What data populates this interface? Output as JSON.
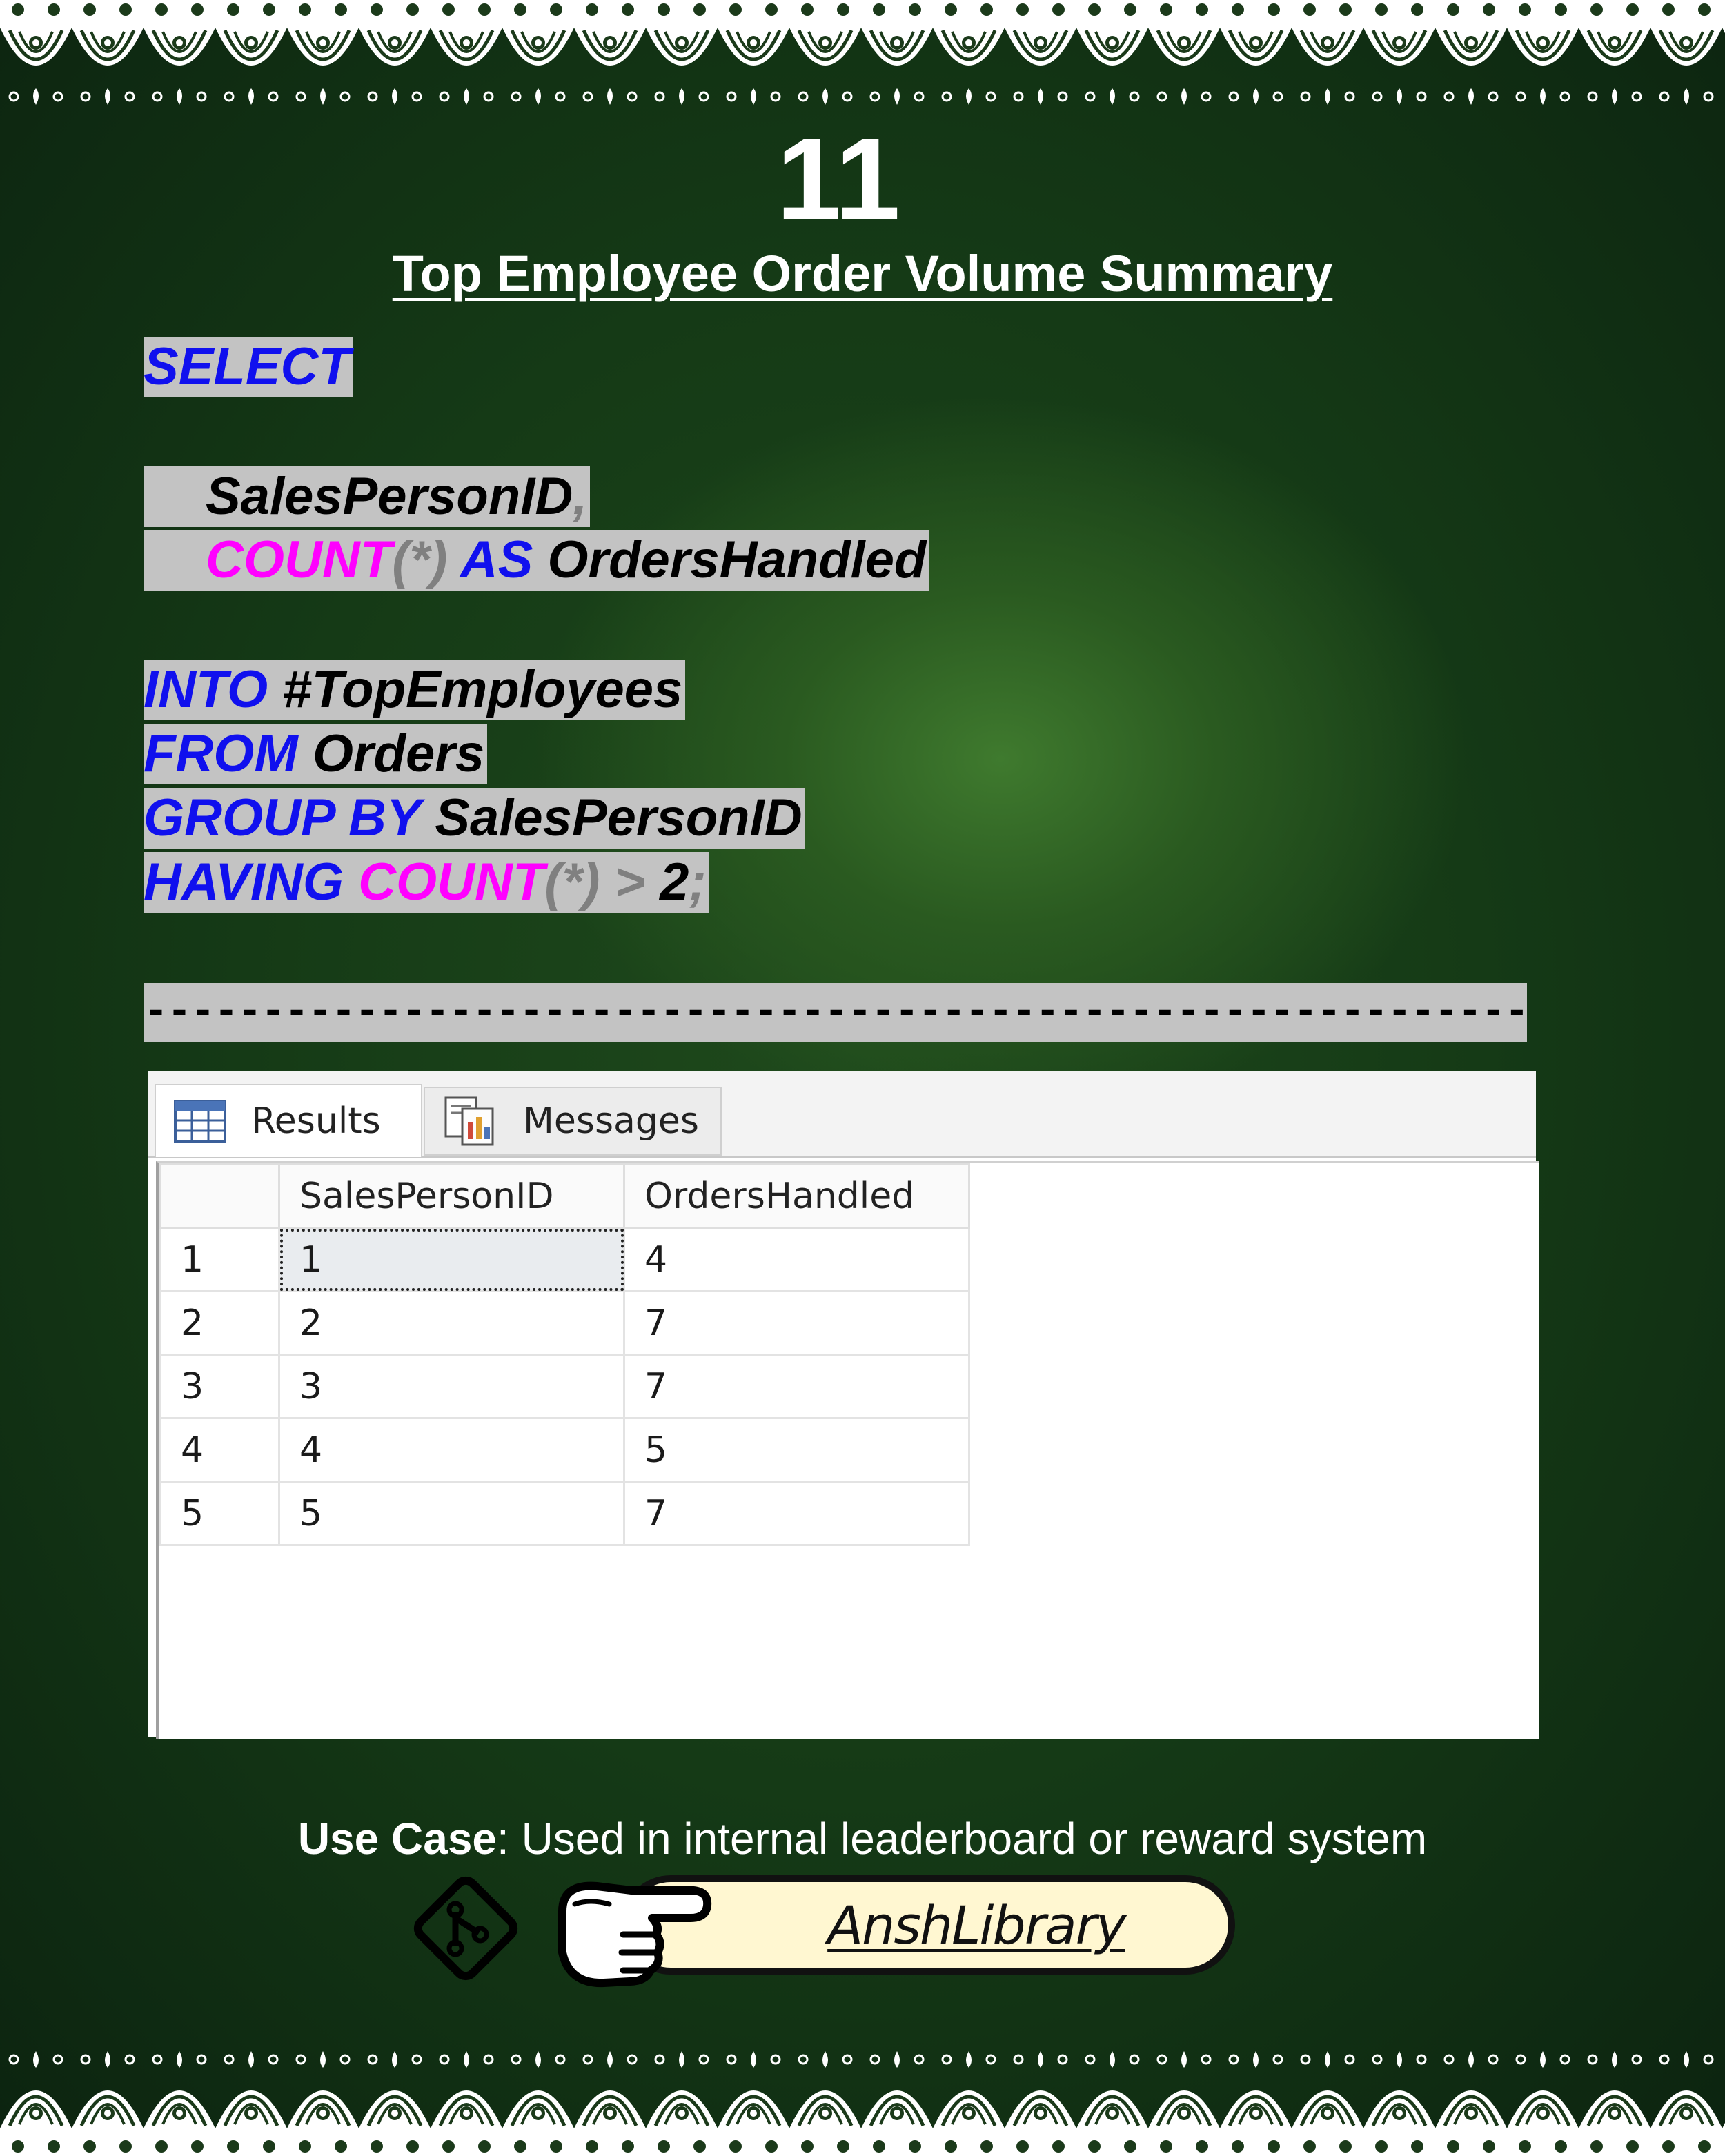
{
  "page_number": "11",
  "title": "Top Employee Order Volume Summary",
  "code": {
    "select": "SELECT",
    "col1": "SalesPersonID",
    "comma": ",",
    "count": "COUNT",
    "star": "(*)",
    "as": "AS",
    "alias": "OrdersHandled",
    "into": "INTO",
    "into_table": "#TopEmployees",
    "from": "FROM",
    "from_table": "Orders",
    "group_by": "GROUP BY",
    "group_col": "SalesPersonID",
    "having": "HAVING",
    "gt": ">",
    "threshold": "2",
    "semicolon": ";"
  },
  "separator": "-------------------------------------------------------------------------------------------------------------------------------------",
  "results": {
    "tabs": [
      {
        "label": "Results",
        "icon": "grid-icon"
      },
      {
        "label": "Messages",
        "icon": "messages-icon"
      }
    ],
    "columns": [
      "",
      "SalesPersonID",
      "OrdersHandled"
    ],
    "rows": [
      {
        "num": "1",
        "id": "1",
        "orders": "4"
      },
      {
        "num": "2",
        "id": "2",
        "orders": "7"
      },
      {
        "num": "3",
        "id": "3",
        "orders": "7"
      },
      {
        "num": "4",
        "id": "4",
        "orders": "5"
      },
      {
        "num": "5",
        "id": "5",
        "orders": "7"
      }
    ]
  },
  "use_case": {
    "label": "Use Case",
    "text": ": Used in internal leaderboard or reward system"
  },
  "footer": {
    "library": "AnshLibrary",
    "icons": [
      "git-icon",
      "pointing-hand-icon"
    ]
  },
  "colors": {
    "keyword": "#1010ee",
    "function": "#ff00ff",
    "code_background": "#c3c3c3",
    "pill_background": "#fff7d1"
  }
}
